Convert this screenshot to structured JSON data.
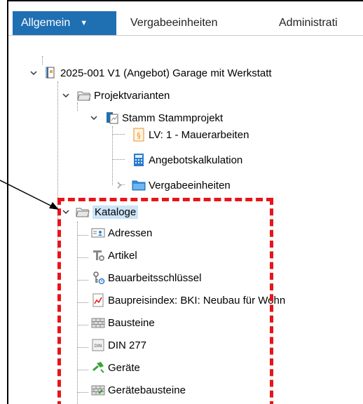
{
  "tabs": [
    {
      "label": "Allgemein",
      "active": true
    },
    {
      "label": "Vergabeeinheiten",
      "active": false
    },
    {
      "label": "Administrati",
      "active": false
    }
  ],
  "tree": {
    "project": "2025-001 V1 (Angebot) Garage mit Werkstatt",
    "projektvarianten": "Projektvarianten",
    "stamm": "Stamm Stammprojekt",
    "lv": "LV: 1 - Mauerarbeiten",
    "angebotskalkulation": "Angebotskalkulation",
    "vergabeeinheiten": "Vergabeeinheiten",
    "kataloge": "Kataloge",
    "catalog_items": [
      {
        "label": "Adressen",
        "icon": "address-card-icon"
      },
      {
        "label": "Artikel",
        "icon": "faucet-icon"
      },
      {
        "label": "Bauarbeitsschlüssel",
        "icon": "key-icon"
      },
      {
        "label": "Baupreisindex: BKI: Neubau für Wohn",
        "icon": "price-index-icon"
      },
      {
        "label": "Bausteine",
        "icon": "brick-icon"
      },
      {
        "label": "DIN 277",
        "icon": "din-icon"
      },
      {
        "label": "Geräte",
        "icon": "hammer-icon"
      },
      {
        "label": "Gerätebausteine",
        "icon": "device-brick-icon"
      }
    ]
  },
  "colors": {
    "accent": "#1f6fb3",
    "highlight": "#e8141a",
    "selection": "#cce4f7"
  }
}
